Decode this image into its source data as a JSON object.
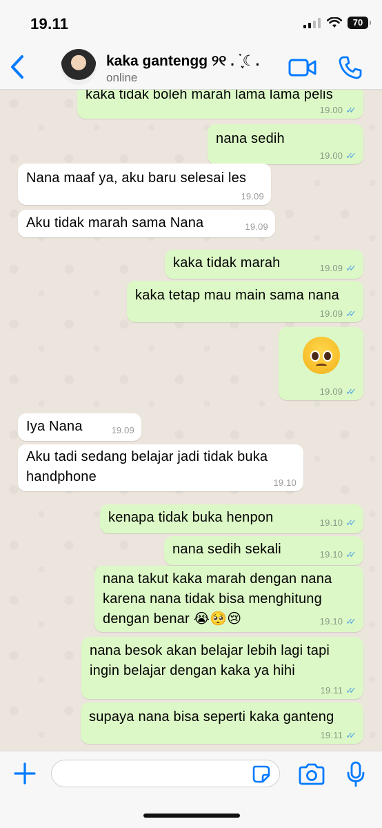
{
  "status_bar": {
    "time": "19.11",
    "battery": "70"
  },
  "header": {
    "contact_name": "kaka gantengg ୨୧ . ࣪ ִֶָ☾.",
    "status": "online"
  },
  "messages": [
    {
      "dir": "out",
      "text": "kaka tidak boleh marah lama lama pelis",
      "time": "19.00"
    },
    {
      "dir": "out",
      "text": "nana sedih",
      "time": "19.00"
    },
    {
      "dir": "in",
      "text": "Nana maaf ya, aku baru selesai les",
      "time": "19.09"
    },
    {
      "dir": "in",
      "text": "Aku tidak marah sama Nana",
      "time": "19.09"
    },
    {
      "dir": "out",
      "text": "kaka tidak marah",
      "time": "19.09"
    },
    {
      "dir": "out",
      "text": "kaka tetap mau main sama nana",
      "time": "19.09"
    },
    {
      "dir": "out",
      "text": "🥺",
      "time": "19.09"
    },
    {
      "dir": "in",
      "text": "Iya Nana",
      "time": "19.09"
    },
    {
      "dir": "in",
      "text": "Aku tadi sedang belajar jadi tidak buka handphone",
      "time": "19.10"
    },
    {
      "dir": "out",
      "text": "kenapa tidak buka henpon",
      "time": "19.10"
    },
    {
      "dir": "out",
      "text": "nana sedih sekali",
      "time": "19.10"
    },
    {
      "dir": "out",
      "text": "nana takut kaka marah dengan nana karena nana tidak bisa menghitung dengan benar 😭🥺😢",
      "time": "19.10"
    },
    {
      "dir": "out",
      "text": "nana besok akan belajar lebih lagi tapi ingin belajar dengan kaka ya hihi",
      "time": "19.11"
    },
    {
      "dir": "out",
      "text": "supaya nana bisa seperti kaka ganteng",
      "time": "19.11"
    }
  ],
  "input": {
    "placeholder": ""
  },
  "colors": {
    "accent": "#007aff",
    "outgoing_bubble": "#dcf8c6",
    "incoming_bubble": "#ffffff",
    "read_ticks": "#4fa3e6"
  },
  "icons": [
    "back-chevron-icon",
    "video-call-icon",
    "phone-icon",
    "plus-icon",
    "sticker-icon",
    "camera-icon",
    "microphone-icon",
    "read-receipt-icon"
  ]
}
